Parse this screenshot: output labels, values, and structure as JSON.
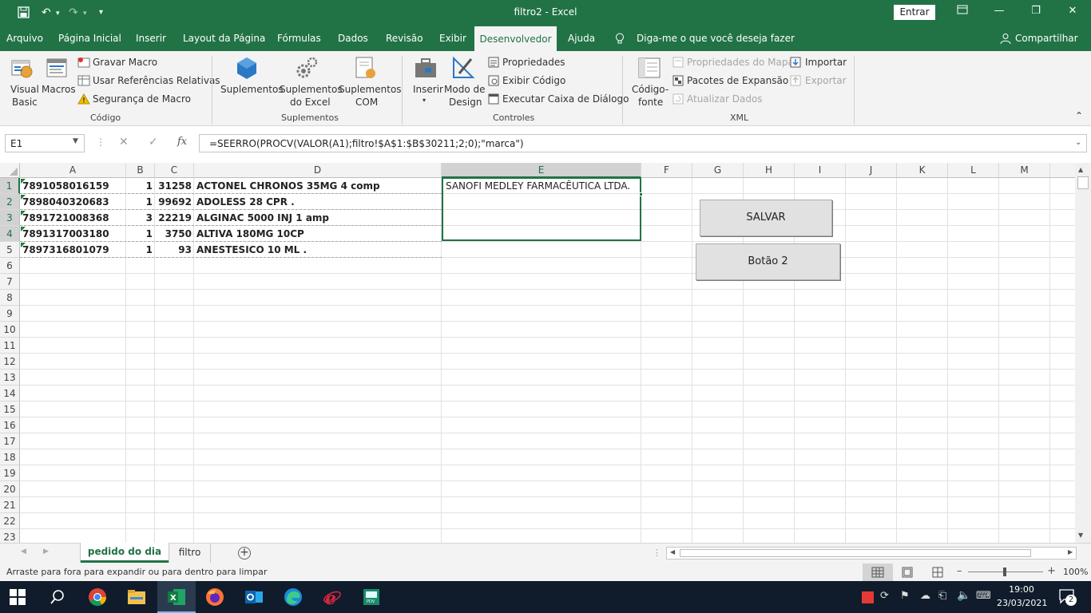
{
  "window": {
    "title": "filtro2 - Excel",
    "sign_in": "Entrar"
  },
  "quick_access": {
    "save": "save-icon",
    "undo": "undo-icon",
    "redo": "redo-icon"
  },
  "menu": {
    "tabs": [
      "Arquivo",
      "Página Inicial",
      "Inserir",
      "Layout da Página",
      "Fórmulas",
      "Dados",
      "Revisão",
      "Exibir",
      "Desenvolvedor",
      "Ajuda"
    ],
    "active": "Desenvolvedor",
    "tell_me": "Diga-me o que você deseja fazer",
    "share": "Compartilhar"
  },
  "ribbon": {
    "code": {
      "visual_basic_1": "Visual",
      "visual_basic_2": "Basic",
      "macros": "Macros",
      "record": "Gravar Macro",
      "relative": "Usar Referências Relativas",
      "security": "Segurança de Macro",
      "group": "Código"
    },
    "addins": {
      "suplementos": "Suplementos",
      "excel_1": "Suplementos",
      "excel_2": "do Excel",
      "com_1": "Suplementos",
      "com_2": "COM",
      "group": "Suplementos"
    },
    "controls": {
      "insert": "Inserir",
      "design_1": "Modo de",
      "design_2": "Design",
      "properties": "Propriedades",
      "view_code": "Exibir Código",
      "run_dialog": "Executar Caixa de Diálogo",
      "group": "Controles"
    },
    "xml": {
      "source_1": "Código-",
      "source_2": "fonte",
      "map_props": "Propriedades do Mapa",
      "expansion": "Pacotes de Expansão",
      "refresh": "Atualizar Dados",
      "import": "Importar",
      "export": "Exportar",
      "group": "XML"
    }
  },
  "formula_bar": {
    "name_box": "E1",
    "fx": "fx",
    "formula": "=SEERRO(PROCV(VALOR(A1);filtro!$A$1:$B$30211;2;0);\"marca\")"
  },
  "columns": [
    "A",
    "B",
    "C",
    "D",
    "E",
    "F",
    "G",
    "H",
    "I",
    "J",
    "K",
    "L",
    "M"
  ],
  "rows": [
    "1",
    "2",
    "3",
    "4",
    "5",
    "6",
    "7",
    "8",
    "9",
    "10",
    "11",
    "12",
    "13",
    "14",
    "15",
    "16",
    "17",
    "18",
    "19",
    "20",
    "21",
    "22",
    "23"
  ],
  "data": [
    {
      "a": "7891058016159",
      "b": "1",
      "c": "31258",
      "d": "ACTONEL CHRONOS 35MG 4 comp"
    },
    {
      "a": "7898040320683",
      "b": "1",
      "c": "99692",
      "d": "ADOLESS 28  CPR ."
    },
    {
      "a": "7891721008368",
      "b": "3",
      "c": "22219",
      "d": "ALGINAC 5000 INJ  1 amp"
    },
    {
      "a": "7891317003180",
      "b": "1",
      "c": "3750",
      "d": "ALTIVA 180MG 10CP"
    },
    {
      "a": "7897316801079",
      "b": "1",
      "c": "93",
      "d": "ANESTESICO 10 ML ."
    }
  ],
  "e1": "SANOFI MEDLEY FARMACÊUTICA LTDA.",
  "buttons": {
    "salvar": "SALVAR",
    "botao2": "Botão 2"
  },
  "sheets": {
    "active": "pedido do dia",
    "other": "filtro"
  },
  "status": {
    "message": "Arraste para fora para expandir ou para dentro para limpar",
    "zoom": "100%"
  },
  "taskbar": {
    "time": "19:00",
    "date": "23/03/2021",
    "notifications": "2"
  }
}
